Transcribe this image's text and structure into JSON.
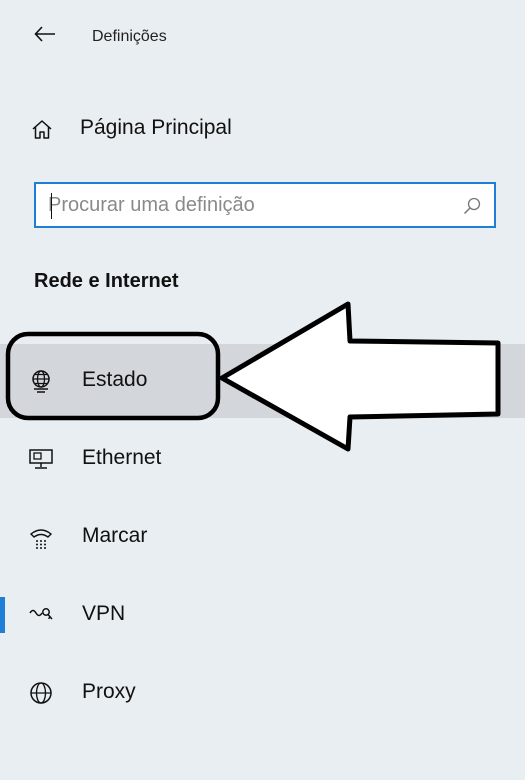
{
  "window": {
    "title": "Definições",
    "back_icon": "arrow-left-icon"
  },
  "home": {
    "label": "Página Principal",
    "icon": "home-icon"
  },
  "search": {
    "placeholder": "Procurar uma definição",
    "value": "",
    "icon": "search-icon"
  },
  "section": {
    "heading": "Rede e Internet"
  },
  "nav": {
    "items": [
      {
        "label": "Estado",
        "icon": "globe-monitor-icon",
        "hovered": true
      },
      {
        "label": "Ethernet",
        "icon": "ethernet-icon"
      },
      {
        "label": "Marcar",
        "icon": "dial-up-icon"
      },
      {
        "label": "VPN",
        "icon": "vpn-icon",
        "selected": true
      },
      {
        "label": "Proxy",
        "icon": "globe-icon"
      }
    ]
  },
  "colors": {
    "background": "#e9eef2",
    "accent": "#1f7fd6",
    "hover": "#d3d7db"
  }
}
